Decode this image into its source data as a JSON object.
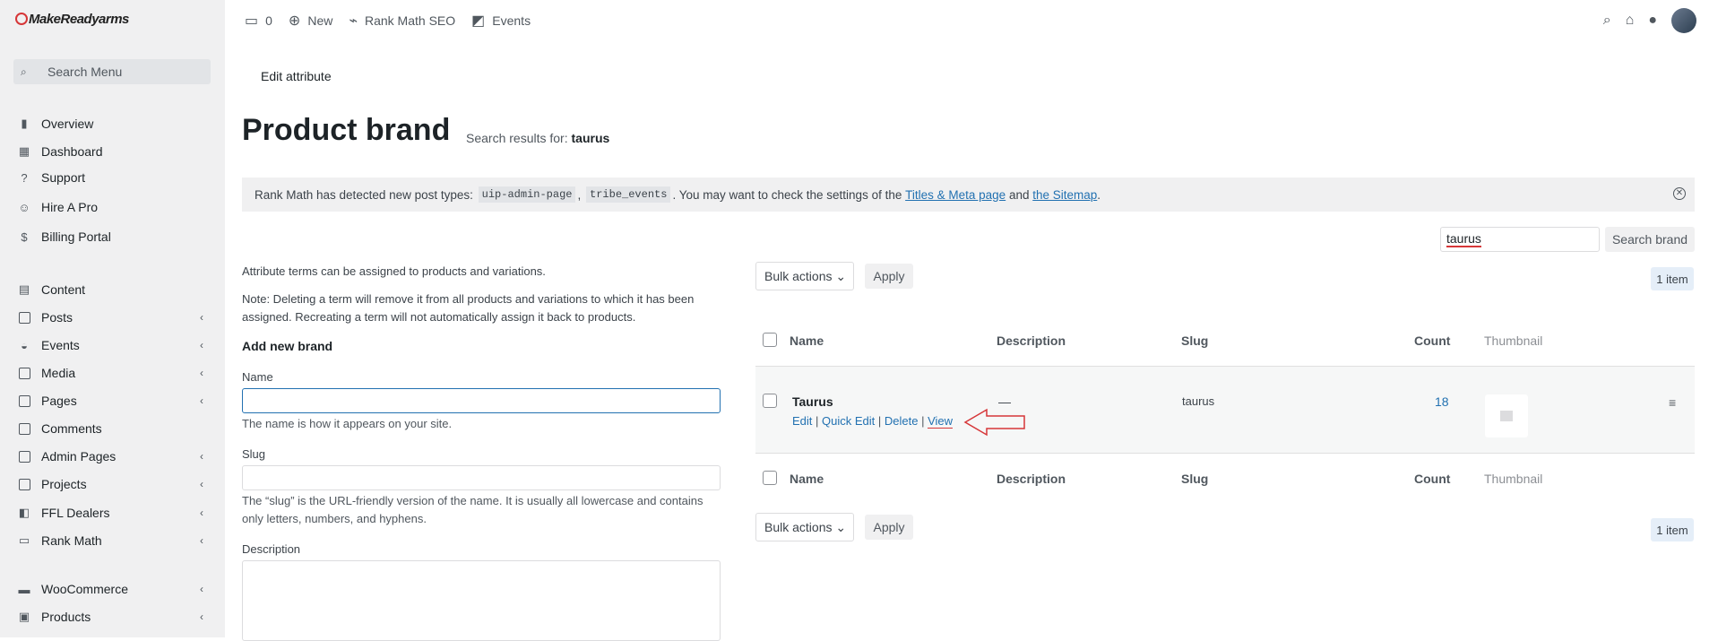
{
  "sidebar": {
    "logo": "MakeReadyarms",
    "search_placeholder": "Search Menu",
    "items": [
      {
        "label": "Overview"
      },
      {
        "label": "Dashboard"
      },
      {
        "label": "Support"
      },
      {
        "label": "Hire A Pro"
      },
      {
        "label": "Billing Portal"
      },
      {
        "label": "Content"
      },
      {
        "label": "Posts"
      },
      {
        "label": "Events"
      },
      {
        "label": "Media"
      },
      {
        "label": "Pages"
      },
      {
        "label": "Comments"
      },
      {
        "label": "Admin Pages"
      },
      {
        "label": "Projects"
      },
      {
        "label": "FFL Dealers"
      },
      {
        "label": "Rank Math"
      },
      {
        "label": "WooCommerce"
      },
      {
        "label": "Products"
      }
    ]
  },
  "topbar": {
    "comments_count": "0",
    "new_label": "New",
    "rank_math_label": "Rank Math SEO",
    "events_label": "Events"
  },
  "breadcrumb": "Edit attribute",
  "page": {
    "title": "Product brand",
    "search_prefix": "Search results for:",
    "search_term": "taurus"
  },
  "notice": {
    "text_before": "Rank Math has detected new post types:",
    "type1": "uip-admin-page",
    "comma": ",",
    "type2": "tribe_events",
    "text_mid": ". You may want to check the settings of the",
    "link1": "Titles & Meta page",
    "and": "and",
    "link2": "the Sitemap",
    "period": "."
  },
  "search": {
    "value": "taurus",
    "button": "Search brand"
  },
  "form": {
    "intro": "Attribute terms can be assigned to products and variations.",
    "note": "Note: Deleting a term will remove it from all products and variations to which it has been assigned. Recreating a term will not automatically assign it back to products.",
    "heading": "Add new brand",
    "name_label": "Name",
    "name_help": "The name is how it appears on your site.",
    "slug_label": "Slug",
    "slug_help": "The “slug” is the URL-friendly version of the name. It is usually all lowercase and contains only letters, numbers, and hyphens.",
    "desc_label": "Description"
  },
  "table": {
    "bulk_label": "Bulk actions",
    "apply_label": "Apply",
    "count_label": "1 item",
    "headers": {
      "name": "Name",
      "description": "Description",
      "slug": "Slug",
      "count": "Count",
      "thumbnail": "Thumbnail"
    },
    "row": {
      "name": "Taurus",
      "description": "—",
      "slug": "taurus",
      "count": "18",
      "actions": {
        "edit": "Edit",
        "quick_edit": "Quick Edit",
        "delete": "Delete",
        "view": "View"
      }
    }
  },
  "colors": {
    "accent": "#2271b1",
    "annotation": "#d63638"
  }
}
